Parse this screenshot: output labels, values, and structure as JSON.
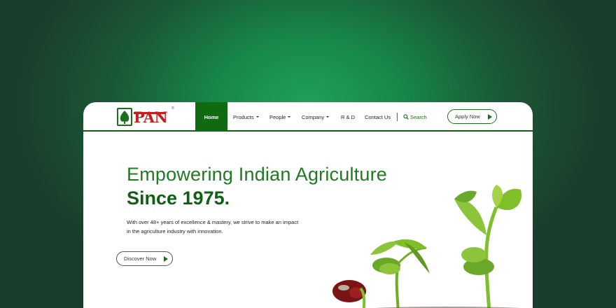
{
  "brand": {
    "logo_text": "PAN",
    "logo_reg": "®"
  },
  "nav": {
    "home": "Home",
    "products": "Products",
    "people": "People",
    "company": "Company",
    "rnd": "R & D",
    "contact": "Contact Us",
    "search": "Search",
    "apply": "Apply Now"
  },
  "hero": {
    "title": "Empowering Indian Agriculture",
    "subtitle": "Since 1975.",
    "description": "With over 48+ years of excellence & mastery, we strive to make an impact in the agriculture industry with innovation.",
    "cta": "Discover Now"
  },
  "colors": {
    "brand_green": "#0f6a12",
    "accent_red": "#c41e1e",
    "background_gradient": "#1fa05a"
  },
  "icons": {
    "search": "search-icon",
    "play": "play-icon",
    "caret": "chevron-down-icon"
  }
}
